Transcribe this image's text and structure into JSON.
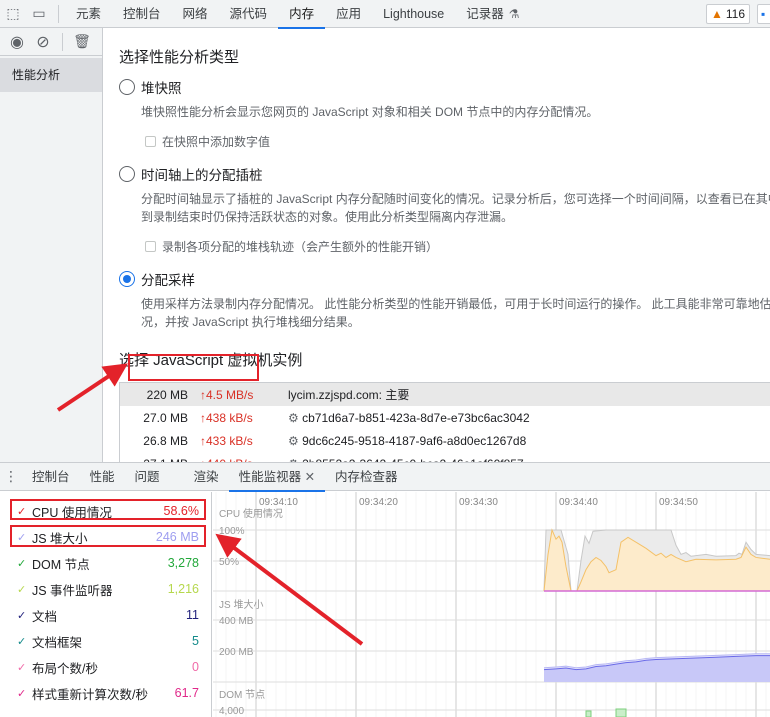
{
  "toolbar": {
    "tabs": [
      "元素",
      "控制台",
      "网络",
      "源代码",
      "内存",
      "应用",
      "Lighthouse",
      "记录器"
    ],
    "active": "内存",
    "warnings": "116"
  },
  "sidebar": {
    "item": "性能分析"
  },
  "main": {
    "title": "选择性能分析类型",
    "options": [
      {
        "label": "堆快照",
        "desc": [
          "堆快照性能分析会显示您网页的 JavaScript 对象和相关 DOM 节点中的内存分配情况。"
        ],
        "checkbox": "在快照中添加数字值",
        "selected": false
      },
      {
        "label": "时间轴上的分配插桩",
        "desc": [
          "分配时间轴显示了插桩的 JavaScript 内存分配随时间变化的情况。记录分析后，您可选择一个时间间隔，以查看已在其中",
          "到录制结束时仍保持活跃状态的对象。使用此分析类型隔离内存泄漏。"
        ],
        "checkbox": "录制各项分配的堆栈轨迹（会产生额外的性能开销）",
        "selected": false
      },
      {
        "label": "分配采样",
        "desc": [
          "使用采样方法录制内存分配情况。 此性能分析类型的性能开销最低，可用于长时间运行的操作。 此工具能非常可靠地估",
          "况，并按 JavaScript 执行堆栈细分结果。"
        ],
        "selected": true
      }
    ],
    "vm_title": "选择 JavaScript 虚拟机实例",
    "vms": [
      {
        "size": "220 MB",
        "rate": "↑4.5 MB/s",
        "name": "lycim.zzjspd.com: 主要",
        "worker": false
      },
      {
        "size": "27.0 MB",
        "rate": "↑438 kB/s",
        "name": "cb71d6a7-b851-423a-8d7e-e73bc6ac3042",
        "worker": true
      },
      {
        "size": "26.8 MB",
        "rate": "↑433 kB/s",
        "name": "9dc6c245-9518-4187-9af6-a8d0ec1267d8",
        "worker": true
      },
      {
        "size": "27.1 MB",
        "rate": "↑440 kB/s",
        "name": "2b8552a2-3642-45c0-bca2-46e1af60f857",
        "worker": true
      }
    ]
  },
  "drawer": {
    "tabs": [
      "控制台",
      "性能",
      "问题",
      "渲染",
      "性能监视器",
      "内存检查器"
    ],
    "active": "性能监视器"
  },
  "metrics": [
    {
      "label": "CPU 使用情况",
      "value": "58.6%",
      "color": "#e3222a"
    },
    {
      "label": "JS 堆大小",
      "value": "246 MB",
      "color": "#9e9ef0"
    },
    {
      "label": "DOM 节点",
      "value": "3,278",
      "color": "#22a83a"
    },
    {
      "label": "JS 事件监听器",
      "value": "1,216",
      "color": "#b6d84e"
    },
    {
      "label": "文档",
      "value": "11",
      "color": "#1f1f7a"
    },
    {
      "label": "文档框架",
      "value": "5",
      "color": "#138a8a"
    },
    {
      "label": "布局个数/秒",
      "value": "0",
      "color": "#f06aa8"
    },
    {
      "label": "样式重新计算次数/秒",
      "value": "61.7",
      "color": "#e0288a"
    }
  ],
  "chart_data": {
    "type": "area",
    "time_ticks": [
      "09:34:10",
      "09:34:20",
      "09:34:30",
      "09:34:40",
      "09:34:50"
    ],
    "cpu": {
      "label": "CPU 使用情况",
      "ticks": [
        "100%",
        "50%"
      ],
      "total": [
        [
          38.8,
          0
        ],
        [
          39.0,
          100
        ],
        [
          40.5,
          100
        ],
        [
          41.2,
          60
        ],
        [
          41.5,
          0
        ],
        [
          42.1,
          0
        ],
        [
          42.5,
          50
        ],
        [
          42.9,
          90
        ],
        [
          43.3,
          78
        ],
        [
          43.7,
          98
        ],
        [
          45,
          100
        ],
        [
          48,
          100
        ],
        [
          51.5,
          100
        ],
        [
          52,
          75
        ],
        [
          52.5,
          60
        ],
        [
          53,
          63
        ],
        [
          53.5,
          57
        ],
        [
          55,
          60
        ],
        [
          56,
          57
        ],
        [
          58,
          58
        ],
        [
          58.3,
          62
        ],
        [
          58.6,
          60
        ],
        [
          59,
          80
        ],
        [
          59.5,
          68
        ],
        [
          60,
          60
        ],
        [
          61.4,
          58
        ]
      ],
      "scripting": [
        [
          38.8,
          0
        ],
        [
          39.2,
          60
        ],
        [
          39.6,
          100
        ],
        [
          40,
          85
        ],
        [
          40.3,
          90
        ],
        [
          40.6,
          80
        ],
        [
          41,
          40
        ],
        [
          41.5,
          0
        ],
        [
          42.1,
          0
        ],
        [
          42.5,
          15
        ],
        [
          43,
          35
        ],
        [
          43.5,
          48
        ],
        [
          44,
          55
        ],
        [
          44.5,
          50
        ],
        [
          45,
          40
        ],
        [
          45.3,
          30
        ],
        [
          46,
          35
        ],
        [
          46.5,
          80
        ],
        [
          47.2,
          88
        ],
        [
          48,
          80
        ],
        [
          49,
          70
        ],
        [
          50,
          58
        ],
        [
          50.5,
          62
        ],
        [
          51,
          55
        ],
        [
          51.5,
          60
        ],
        [
          52,
          55
        ],
        [
          53,
          48
        ],
        [
          54,
          52
        ],
        [
          56,
          51
        ],
        [
          58,
          52
        ],
        [
          58.5,
          55
        ],
        [
          59,
          72
        ],
        [
          59.5,
          60
        ],
        [
          60,
          55
        ],
        [
          61.4,
          52
        ]
      ]
    },
    "heap": {
      "label": "JS 堆大小",
      "ticks": [
        "400 MB",
        "200 MB"
      ],
      "used": [
        [
          38.8,
          80
        ],
        [
          40,
          85
        ],
        [
          41,
          90
        ],
        [
          42,
          80
        ],
        [
          43,
          85
        ],
        [
          44,
          100
        ],
        [
          45,
          105
        ],
        [
          46,
          115
        ],
        [
          47,
          125
        ],
        [
          48,
          130
        ],
        [
          49,
          140
        ],
        [
          50,
          145
        ],
        [
          52,
          150
        ],
        [
          54,
          155
        ],
        [
          56,
          160
        ],
        [
          58,
          165
        ],
        [
          60,
          170
        ],
        [
          61.4,
          170
        ]
      ]
    },
    "dom": {
      "label": "DOM 节点",
      "ticks": [
        "4,000"
      ]
    }
  }
}
